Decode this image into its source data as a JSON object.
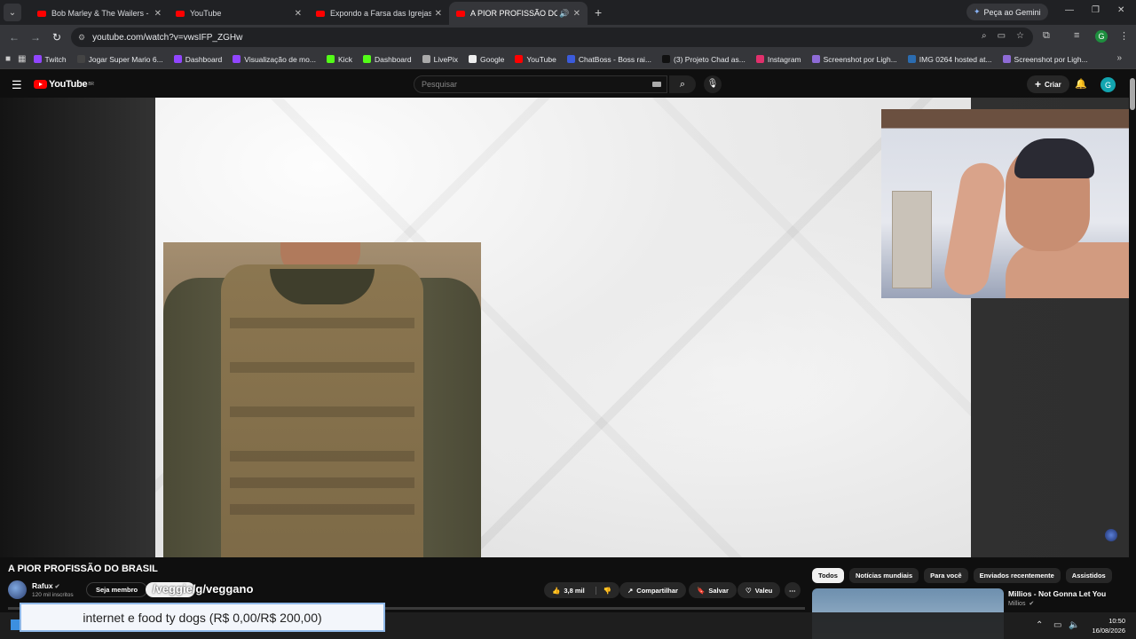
{
  "browser": {
    "tabs": [
      {
        "title": "Bob Marley & The Wailers - Exo",
        "active": false
      },
      {
        "title": "YouTube",
        "active": false
      },
      {
        "title": "Expondo a Farsa das Igrejas Eva",
        "active": false
      },
      {
        "title": "A PIOR PROFISSÃO DO BRA",
        "active": true
      }
    ],
    "gemini_label": "Peça ao Gemini",
    "url": "youtube.com/watch?v=vwsIFP_ZGHw",
    "profile_letter": "G",
    "bookmarks": [
      {
        "label": "Twitch",
        "icon": "twitch-icon",
        "color": "#9146ff"
      },
      {
        "label": "Jogar Super Mario 6...",
        "icon": "game-icon",
        "color": "#444444"
      },
      {
        "label": "Dashboard",
        "icon": "twitch-icon",
        "color": "#9146ff"
      },
      {
        "label": "Visualização de mo...",
        "icon": "twitch-icon",
        "color": "#9146ff"
      },
      {
        "label": "Kick",
        "icon": "kick-icon",
        "color": "#53fc18"
      },
      {
        "label": "Dashboard",
        "icon": "kick-icon",
        "color": "#53fc18"
      },
      {
        "label": "LivePix",
        "icon": "livepix-icon",
        "color": "#aaaaaa"
      },
      {
        "label": "Google",
        "icon": "google-icon",
        "color": "#eeeeee"
      },
      {
        "label": "YouTube",
        "icon": "youtube-icon",
        "color": "#ff0000"
      },
      {
        "label": "ChatBoss - Boss rai...",
        "icon": "chatboss-icon",
        "color": "#3b5bdb"
      },
      {
        "label": "(3) Projeto Chad as...",
        "icon": "x-icon",
        "color": "#111111"
      },
      {
        "label": "Instagram",
        "icon": "instagram-icon",
        "color": "#e1306c"
      },
      {
        "label": "Screenshot por Ligh...",
        "icon": "lightshot-icon",
        "color": "#8e6bd6"
      },
      {
        "label": "IMG 0264 hosted at...",
        "icon": "imgbb-icon",
        "color": "#2b6cb0"
      },
      {
        "label": "Screenshot por Ligh...",
        "icon": "lightshot-icon",
        "color": "#8e6bd6"
      }
    ]
  },
  "youtube": {
    "logo_text": "YouTube",
    "logo_country": "BR",
    "search_placeholder": "Pesquisar",
    "create_label": "Criar",
    "avatar_letter": "G"
  },
  "video": {
    "title": "A PIOR PROFISSÃO DO BRASIL",
    "channel": "Rafux",
    "subscribers": "120 mil inscritos",
    "join_label": "Seja membro",
    "overlay_text": "/veggie/g/veggano",
    "likes": "3,8 mil",
    "share_label": "Compartilhar",
    "save_label": "Salvar",
    "thanks_label": "Valeu"
  },
  "sidebar": {
    "chips": [
      "Todos",
      "Notícias mundiais",
      "Para você",
      "Enviados recentemente",
      "Assistidos"
    ],
    "recommendation": {
      "title": "Millios - Not Gonna Let You",
      "channel": "Millios"
    }
  },
  "donation": {
    "text": "internet e food ty dogs (R$ 0,00/R$ 200,00)",
    "raised": 0,
    "goal": 200
  },
  "taskbar": {
    "time": "10:50",
    "date": "16/08/2026"
  }
}
